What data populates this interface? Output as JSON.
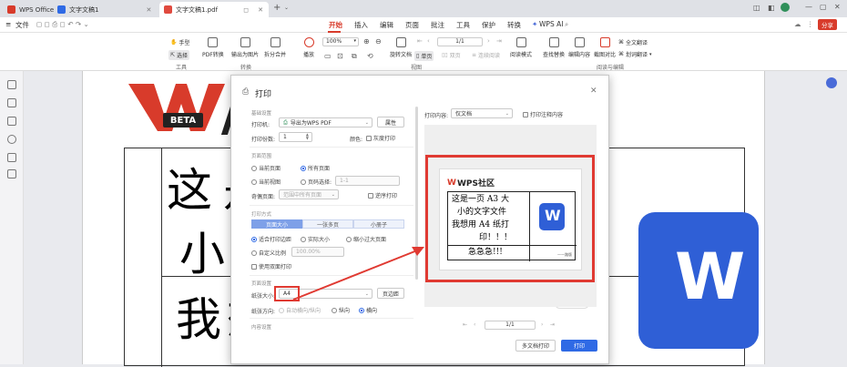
{
  "tabs": [
    {
      "label": "WPS Office"
    },
    {
      "label": "文字文稿1"
    },
    {
      "label": "文字文稿1.pdf"
    }
  ],
  "menubar": {
    "file": "文件",
    "items": [
      "开始",
      "插入",
      "编辑",
      "页面",
      "批注",
      "工具",
      "保护",
      "转换"
    ],
    "active": "开始",
    "ai": "WPS AI",
    "share": "分享"
  },
  "ribbon": {
    "hand": "手型",
    "select": "选择",
    "tools_group": "工具",
    "pdf_convert": "PDF转换",
    "export_image": "输出为图片",
    "split_merge": "拆分合并",
    "convert_group": "转换",
    "play": "播放",
    "zoom": "100%",
    "rotate_doc": "旋转文档",
    "single_page": "单页",
    "double_page": "双页",
    "continuous": "连续阅读",
    "read_mode": "阅读模式",
    "page_num": "1/1",
    "view_group": "视图",
    "find_replace": "查找替换",
    "edit_content": "编辑内容",
    "screenshot_compare": "截图对比",
    "full_translate": "全文翻译",
    "translate_word": "划词翻译",
    "read_edit_group": "阅读与编辑"
  },
  "document": {
    "logo_text": "BETA",
    "chars": [
      "这",
      "是",
      "小",
      "我",
      "想"
    ]
  },
  "dialog": {
    "title": "打印",
    "basic_section": "基础设置",
    "printer_label": "打印机:",
    "printer_value": "导出为WPS PDF",
    "properties": "属性",
    "copies_label": "打印份数:",
    "copies_value": "1",
    "color_label": "颜色:",
    "grayscale": "灰度打印",
    "range_section": "页面范围",
    "current_page": "当前页面",
    "all_pages": "所有页面",
    "current_view": "当前视图",
    "page_select": "页码选择:",
    "page_select_placeholder": "1-1",
    "odd_even_label": "奇偶页面:",
    "odd_even_value": "范围中所有页面",
    "reverse": "逆序打印",
    "mode_section": "打印方式",
    "mode_tabs": [
      "页面大小",
      "一张多页",
      "小册子"
    ],
    "fit_margin": "适合打印边距",
    "actual_size": "实际大小",
    "shrink_large": "缩小过大页面",
    "custom_scale": "自定义比例",
    "scale_value": "100.00%",
    "duplex": "使用双面打印",
    "setup_section": "页面设置",
    "paper_label": "纸张大小:",
    "paper_value": "A4",
    "page_setup": "页边距",
    "orientation_label": "纸张方向:",
    "auto_orient": "自动横向/纵向",
    "portrait": "纵向",
    "landscape": "横向",
    "content_section": "内容设置",
    "print_content_label": "打印内容:",
    "print_content_value": "仅文档",
    "print_annotations": "打印注释内容",
    "edit": "编辑",
    "preview_page": "1/1",
    "multi_print": "多文档打印",
    "print": "打印"
  },
  "preview": {
    "brand": "WPS社区",
    "lines": [
      "这是一页 A3 大",
      "小的文字文件",
      "我想用 A4 纸打",
      "印！！！"
    ],
    "urgent": "急急急!!!",
    "footer": "——路版"
  },
  "colors": {
    "accent": "#d83b2b",
    "primary": "#2f6ae5",
    "highlight": "#e03a32"
  }
}
